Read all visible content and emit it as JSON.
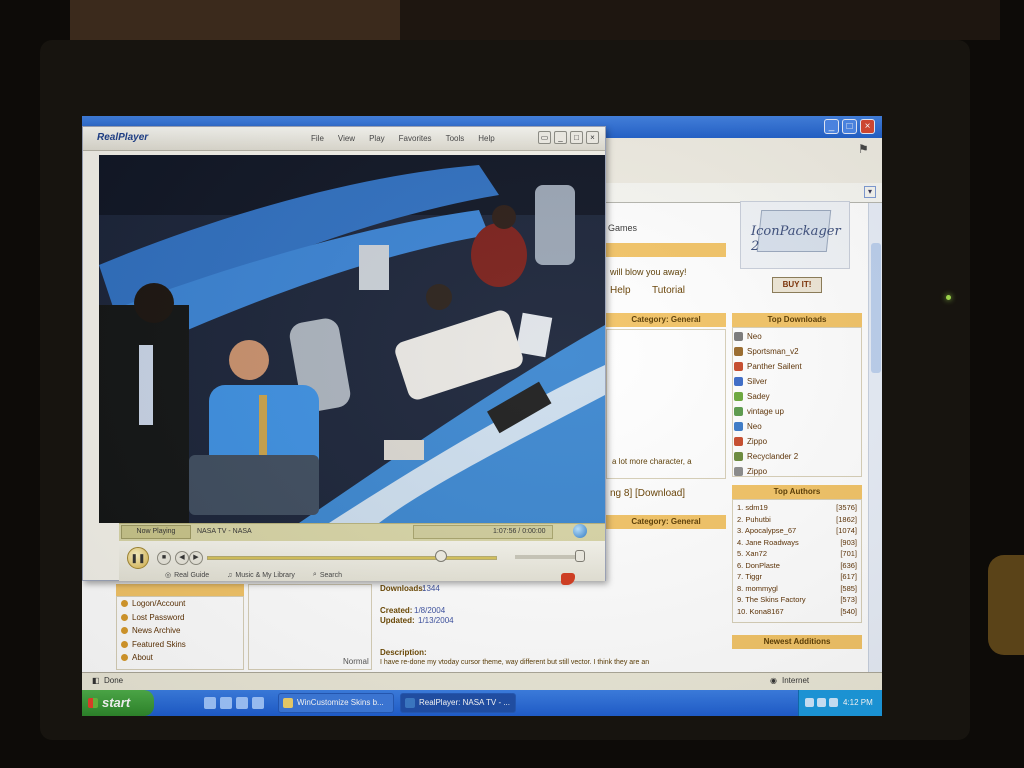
{
  "realplayer": {
    "logo": "RealPlayer",
    "menu": [
      "File",
      "View",
      "Play",
      "Favorites",
      "Tools",
      "Help"
    ],
    "now_playing_tab": "Now Playing",
    "clip_title": "NASA TV - NASA",
    "time": "1:07:56 / 0:00:00",
    "links": [
      "Real Guide",
      "Music & My Library",
      "Search"
    ]
  },
  "browser": {
    "status": "Done",
    "zone": "Internet",
    "tabs_partial": "Games",
    "partial_text_1": "will blow you away!",
    "partial_links": [
      "Help",
      "Tutorial"
    ],
    "category_header_1": "Category: General",
    "category_header_2": "Category: General",
    "description_snippet": "a lot more character, a",
    "download_links": "ng 8] [Download]",
    "detail_downloads_label": "Downloads:",
    "detail_downloads_value": "1344",
    "detail_created_label": "Created:",
    "detail_created_value": "1/8/2004",
    "detail_updated_label": "Updated:",
    "detail_updated_value": "1/13/2004",
    "detail_description_label": "Description:",
    "detail_description_text": "I have re-done my vtoday cursor theme, way different but still vector. I think they are an",
    "thumb_caption": "Normal",
    "banner_text": "IconPackager 2",
    "buy_label": "BUY IT!",
    "top_downloads_header": "Top Downloads",
    "top_downloads": [
      {
        "name": "Neo",
        "color": "#7a7a7a"
      },
      {
        "name": "Sportsman_v2",
        "color": "#9a6a2a"
      },
      {
        "name": "Panther Sailent",
        "color": "#c84a2a"
      },
      {
        "name": "Silver",
        "color": "#3a6ac8"
      },
      {
        "name": "Sadey",
        "color": "#6aa83a"
      },
      {
        "name": "vintage up",
        "color": "#5a9a4a"
      },
      {
        "name": "Neo",
        "color": "#3a7ac8"
      },
      {
        "name": "Zippo",
        "color": "#c84a2a"
      },
      {
        "name": "Recyclander 2",
        "color": "#6a8a3a"
      },
      {
        "name": "Zippo",
        "color": "#8a8a8a"
      }
    ],
    "top_authors_header": "Top Authors",
    "top_authors": [
      {
        "name": "1. sdm19",
        "count": "[3576]"
      },
      {
        "name": "2. Puhutbi",
        "count": "[1862]"
      },
      {
        "name": "3. Apocalypse_67",
        "count": "[1074]"
      },
      {
        "name": "4. Jane Roadways",
        "count": "[903]"
      },
      {
        "name": "5. Xan72",
        "count": "[701]"
      },
      {
        "name": "6. DonPlaste",
        "count": "[636]"
      },
      {
        "name": "7. Tiggr",
        "count": "[617]"
      },
      {
        "name": "8. mommygl",
        "count": "[585]"
      },
      {
        "name": "9. The Skins Factory",
        "count": "[573]"
      },
      {
        "name": "10. Kona8167",
        "count": "[540]"
      }
    ],
    "newest_header": "Newest Additions",
    "nav": [
      "Logon/Account",
      "Lost Password",
      "News Archive",
      "Featured Skins",
      "About"
    ]
  },
  "taskbar": {
    "start": "start",
    "tasks": [
      "WinCustomize Skins b...",
      "RealPlayer: NASA TV - ..."
    ],
    "clock": "4:12 PM"
  },
  "colors": {
    "section_header": "#f3c466",
    "taskbar": "#1d5dd0",
    "start_button": "#2f8a2c"
  }
}
